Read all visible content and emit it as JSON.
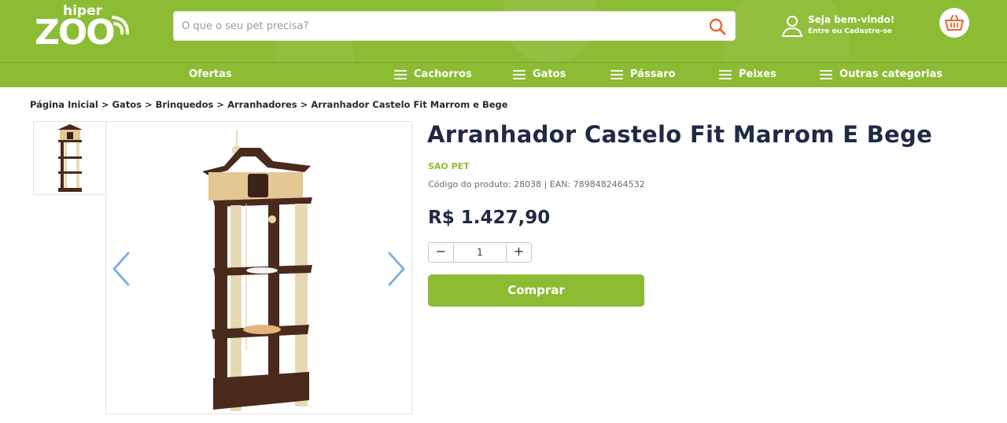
{
  "header": {
    "logo_top": "hiper",
    "logo_main": "ZOO",
    "search_placeholder": "O que o seu pet precisa?",
    "welcome_text": "Seja bem-vindo!",
    "login_text": "Entre ou Cadastre-se"
  },
  "nav": {
    "items": [
      {
        "label": "Ofertas",
        "icon": "none"
      },
      {
        "label": "Cachorros",
        "icon": "menu-icon"
      },
      {
        "label": "Gatos",
        "icon": "menu-icon"
      },
      {
        "label": "Pássaro",
        "icon": "menu-icon"
      },
      {
        "label": "Peixes",
        "icon": "menu-icon"
      },
      {
        "label": "Outras categorias",
        "icon": "menu-icon"
      }
    ]
  },
  "breadcrumb": {
    "items": [
      "Página Inicial",
      "Gatos",
      "Brinquedos",
      "Arranhadores",
      "Arranhador Castelo Fit Marrom e Bege"
    ],
    "separator": " > "
  },
  "product": {
    "title": "Arranhador Castelo Fit Marrom E Bege",
    "brand": "SAO PET",
    "codes": "Código do produto: 28038 | EAN: 7898482464532",
    "price": "R$ 1.427,90",
    "quantity": "1",
    "buy_label": "Comprar"
  },
  "colors": {
    "brand_green": "#8cbc34",
    "text_dark": "#1f2a44",
    "cart_orange": "#e8672c",
    "arrow_blue": "#7fb1e0"
  }
}
